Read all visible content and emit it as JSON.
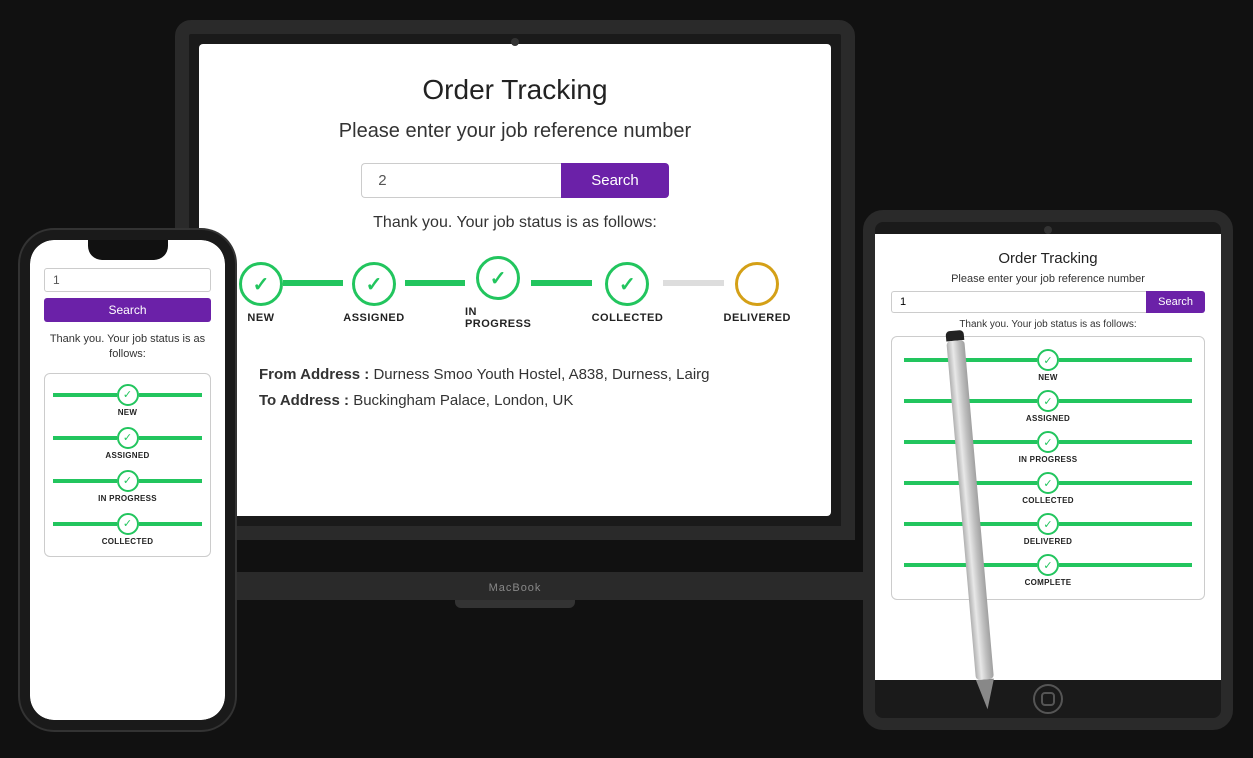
{
  "laptop": {
    "title": "Order Tracking",
    "subtitle": "Please enter your job reference number",
    "input_value": "2",
    "search_label": "Search",
    "status_text": "Thank you. Your job status is as follows:",
    "steps": [
      {
        "label": "NEW",
        "state": "done"
      },
      {
        "label": "ASSIGNED",
        "state": "done"
      },
      {
        "label": "IN PROGRESS",
        "state": "done"
      },
      {
        "label": "COLLECTED",
        "state": "done"
      },
      {
        "label": "DELIVERED",
        "state": "pending"
      }
    ],
    "from_address_label": "From Address :",
    "from_address_value": "Durness Smoo Youth Hostel, A838, Durness, Lairg",
    "to_address_label": "To Address :",
    "to_address_value": "Buckingham Palace, London, UK",
    "brand": "MacBook"
  },
  "phone": {
    "input_value": "1",
    "search_label": "Search",
    "status_text": "Thank you. Your job status is as follows:",
    "steps": [
      {
        "label": "NEW"
      },
      {
        "label": "ASSIGNED"
      },
      {
        "label": "IN PROGRESS"
      },
      {
        "label": "COLLECTED"
      }
    ]
  },
  "tablet": {
    "title": "Order Tracking",
    "subtitle": "Please enter your job reference number",
    "input_value": "1",
    "search_label": "Search",
    "status_text": "Thank you. Your job status is as follows:",
    "steps": [
      {
        "label": "NEW"
      },
      {
        "label": "ASSIGNED"
      },
      {
        "label": "IN PROGRESS"
      },
      {
        "label": "COLLECTED"
      },
      {
        "label": "DELIVERED"
      },
      {
        "label": "COMPLETE"
      }
    ]
  },
  "colors": {
    "purple": "#6b21a8",
    "green": "#22c55e",
    "yellow": "#d4a017"
  }
}
